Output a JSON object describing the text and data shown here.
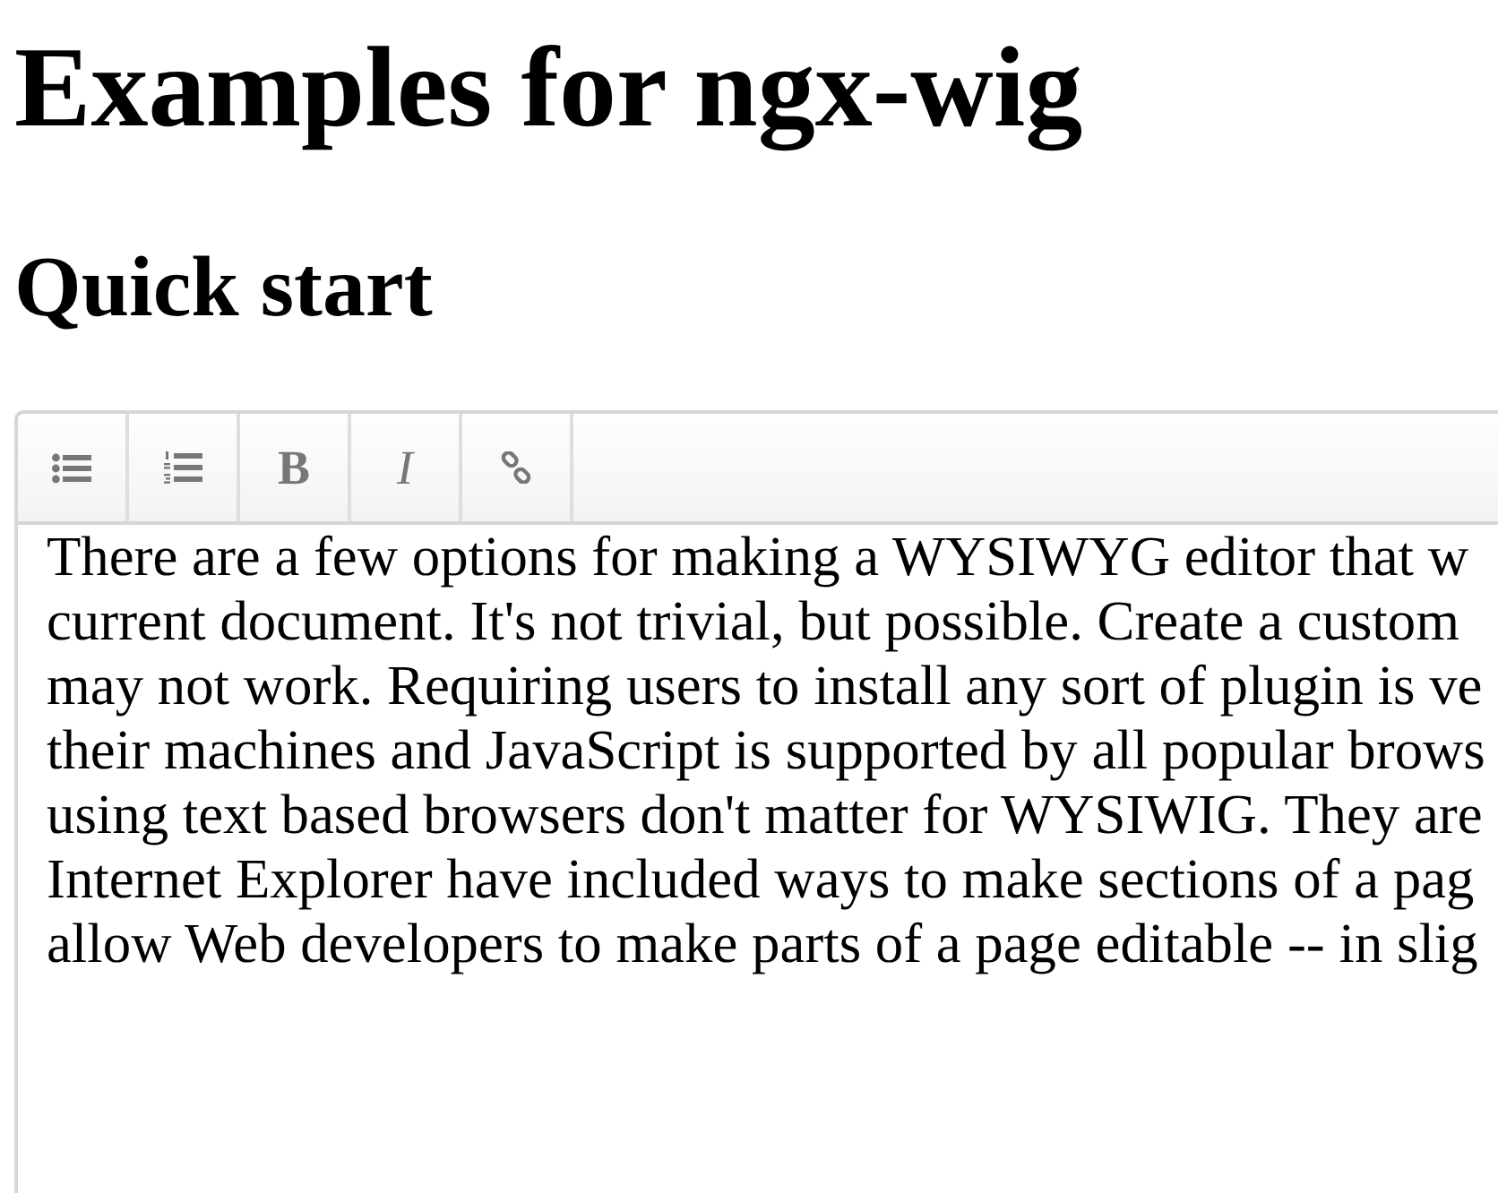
{
  "page": {
    "title": "Examples for ngx-wig",
    "subtitle": "Quick start"
  },
  "editor": {
    "toolbar": [
      {
        "kind": "bullet-list"
      },
      {
        "kind": "numbered-list"
      },
      {
        "kind": "bold",
        "label": "B"
      },
      {
        "kind": "italic",
        "label": "I"
      },
      {
        "kind": "link"
      }
    ],
    "text_lines": [
      "There are a few options for making a WYSIWYG editor that w",
      "current document. It's not trivial, but possible. Create a custom",
      "may not work. Requiring users to install any sort of plugin is ve",
      "their machines and JavaScript is supported by all popular brows",
      "using text based browsers don't matter for WYSIWIG. They are",
      "Internet Explorer have included ways to make sections of a pag",
      "allow Web developers to make parts of a page editable -- in slig"
    ]
  }
}
